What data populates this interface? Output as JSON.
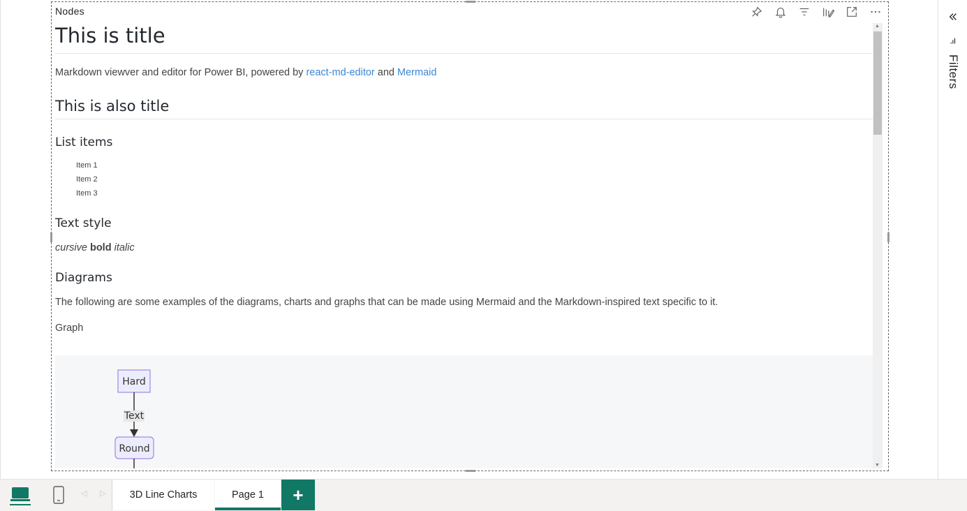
{
  "visual": {
    "header_title": "Nodes",
    "toolbar": {
      "pin": "pin-icon",
      "alert": "bell-icon",
      "filter": "filter-icon",
      "format": "format-visual-icon",
      "focus": "focus-mode-icon",
      "more": "more-options-icon"
    }
  },
  "markdown": {
    "h1": "This is title",
    "intro_prefix": "Markdown viewver and editor for Power BI, powered by ",
    "link1": "react-md-editor",
    "intro_and": " and ",
    "link2": "Mermaid",
    "h2": "This is also title",
    "list_heading": "List items",
    "list_items": [
      "Item 1",
      "Item 2",
      "Item 3"
    ],
    "text_style_heading": "Text style",
    "style_cursive": "cursive",
    "style_bold": "bold",
    "style_italic": "italic",
    "diagrams_heading": "Diagrams",
    "diagrams_paragraph": "The following are some examples of the diagrams, charts and graphs that can be made using Mermaid and the Markdown-inspired text specific to it.",
    "graph_label": "Graph"
  },
  "diagram": {
    "node1": "Hard",
    "edge_label": "Text",
    "node2": "Round"
  },
  "right_pane": {
    "collapse_icon": "double-chevron-left-icon",
    "filter_icon": "filter-icon",
    "label": "Filters"
  },
  "bottom_bar": {
    "tabs": [
      "3D Line Charts",
      "Page 1"
    ],
    "add_label": "+",
    "accent": "#117865"
  }
}
